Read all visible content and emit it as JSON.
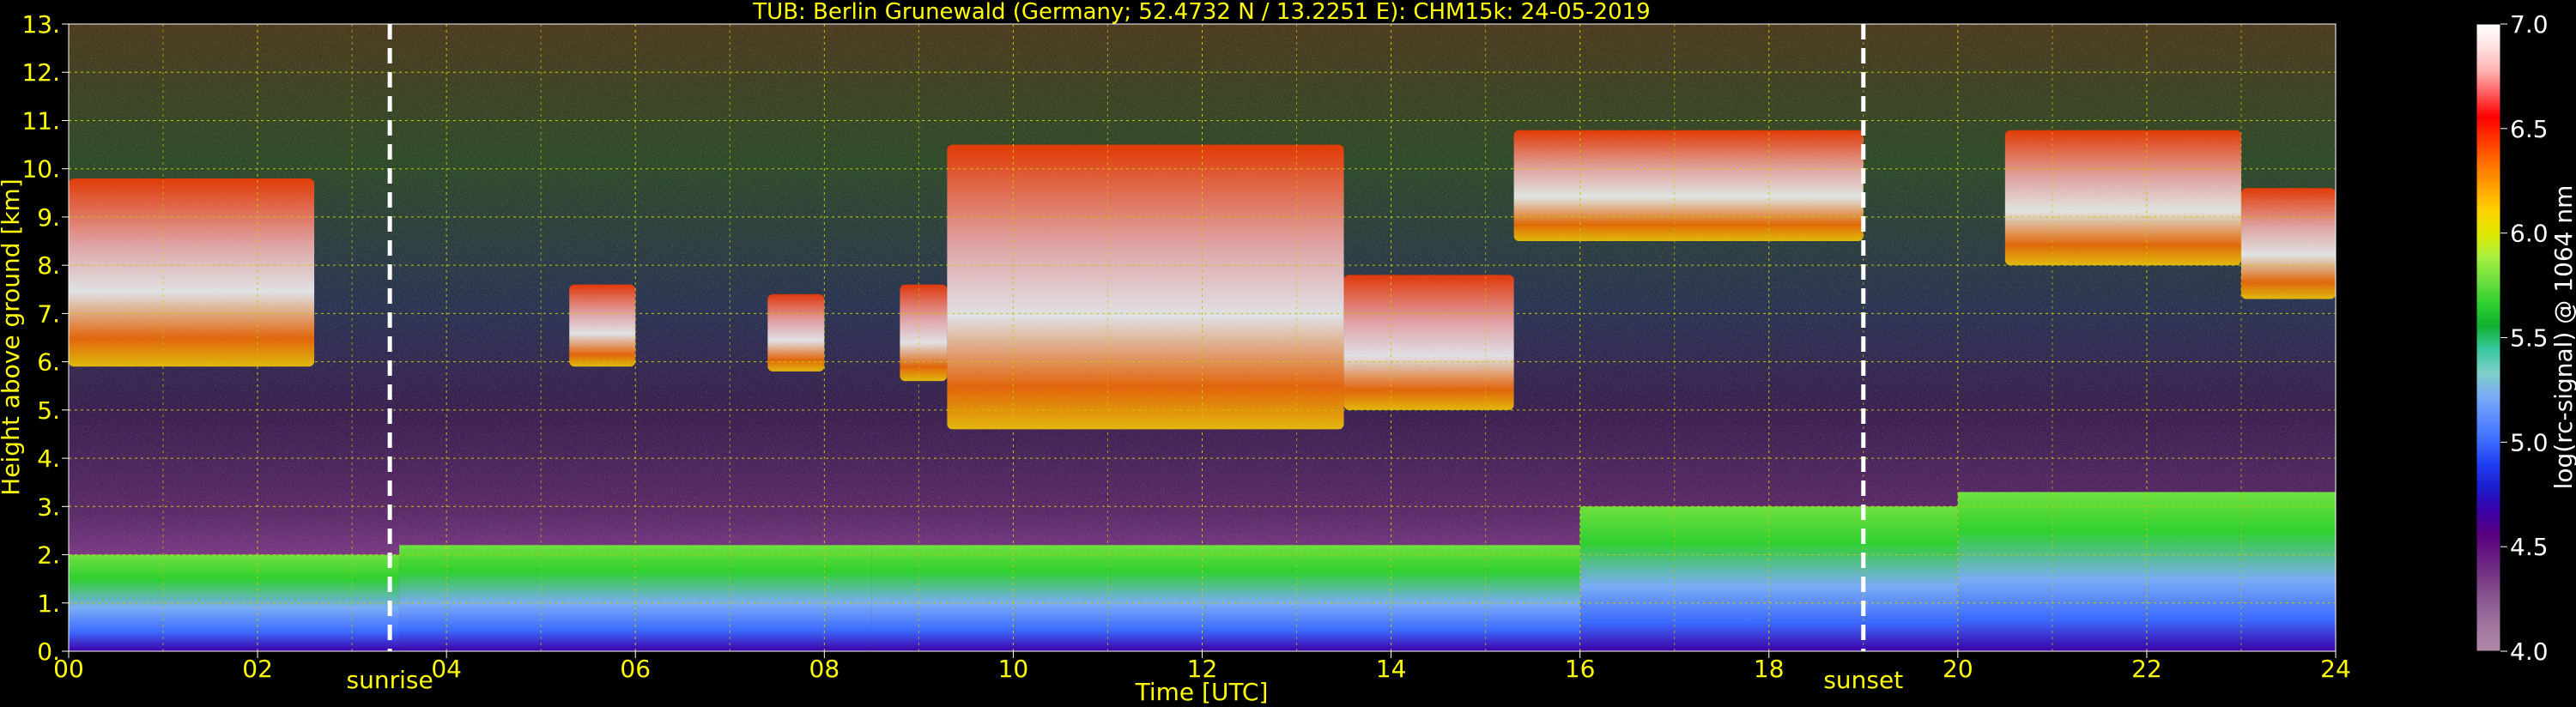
{
  "chart_data": {
    "type": "heatmap",
    "title": "TUB: Berlin Grunewald (Germany; 52.4732 N / 13.2251 E):    CHM15k: 24-05-2019",
    "xlabel": "Time [UTC]",
    "ylabel": "Height above ground [km]",
    "xlim": [
      0,
      24
    ],
    "ylim": [
      0,
      13
    ],
    "x_tick_labels": [
      "00",
      "02",
      "04",
      "06",
      "08",
      "10",
      "12",
      "14",
      "16",
      "18",
      "20",
      "22",
      "24"
    ],
    "x_tick_values": [
      0,
      2,
      4,
      6,
      8,
      10,
      12,
      14,
      16,
      18,
      20,
      22,
      24
    ],
    "y_tick_labels": [
      "0.",
      "1.",
      "2.",
      "3.",
      "4.",
      "5.",
      "6.",
      "7.",
      "8.",
      "9.",
      "10.",
      "11.",
      "12.",
      "13."
    ],
    "y_tick_values": [
      0,
      1,
      2,
      3,
      4,
      5,
      6,
      7,
      8,
      9,
      10,
      11,
      12,
      13
    ],
    "grid": true,
    "grid_color": "#c8c800",
    "colorbar": {
      "label": "log(rc-signal) @ 1064 nm",
      "range": [
        4.0,
        7.0
      ],
      "tick_labels": [
        "4.0",
        "4.5",
        "5.0",
        "5.5",
        "6.0",
        "6.5",
        "7.0"
      ],
      "tick_values": [
        4.0,
        4.5,
        5.0,
        5.5,
        6.0,
        6.5,
        7.0
      ],
      "colors": [
        "#b08aa8",
        "#a178a0",
        "#8f5e94",
        "#7a3f86",
        "#6a1f83",
        "#5a007e",
        "#3c00a5",
        "#1c1ccb",
        "#1e3cf0",
        "#3c6bff",
        "#5a8bff",
        "#7aacf5",
        "#7fd0c8",
        "#38c8a0",
        "#10b030",
        "#30d030",
        "#70e040",
        "#a8f040",
        "#e0e800",
        "#ffd000",
        "#ffa000",
        "#ff7000",
        "#ff3800",
        "#ff0000",
        "#ff5a5a",
        "#ffb4b4",
        "#ffe0e0",
        "#ffffff"
      ]
    },
    "annotations": [
      {
        "text": "sunrise",
        "x": 3.4
      },
      {
        "text": "sunset",
        "x": 19.0
      }
    ],
    "cloud_layers": [
      {
        "x0": 0.0,
        "x1": 2.6,
        "ymin": 5.9,
        "ymax": 9.8
      },
      {
        "x0": 5.3,
        "x1": 6.0,
        "ymin": 5.9,
        "ymax": 7.6
      },
      {
        "x0": 7.4,
        "x1": 8.0,
        "ymin": 5.8,
        "ymax": 7.4
      },
      {
        "x0": 8.8,
        "x1": 9.3,
        "ymin": 5.6,
        "ymax": 7.6
      },
      {
        "x0": 9.3,
        "x1": 13.5,
        "ymin": 4.6,
        "ymax": 10.5
      },
      {
        "x0": 13.5,
        "x1": 15.3,
        "ymin": 5.0,
        "ymax": 7.8
      },
      {
        "x0": 15.3,
        "x1": 19.0,
        "ymin": 8.5,
        "ymax": 10.8
      },
      {
        "x0": 20.5,
        "x1": 23.0,
        "ymin": 8.0,
        "ymax": 10.8
      },
      {
        "x0": 23.0,
        "x1": 24.0,
        "ymin": 7.3,
        "ymax": 9.6
      }
    ],
    "boundary_layer": [
      {
        "x0": 0.0,
        "x1": 3.5,
        "top": 2.0
      },
      {
        "x0": 3.5,
        "x1": 8.5,
        "top": 2.2
      },
      {
        "x0": 8.5,
        "x1": 16.0,
        "top": 2.2
      },
      {
        "x0": 16.0,
        "x1": 20.0,
        "top": 3.0
      },
      {
        "x0": 20.0,
        "x1": 24.0,
        "top": 3.3
      }
    ]
  }
}
